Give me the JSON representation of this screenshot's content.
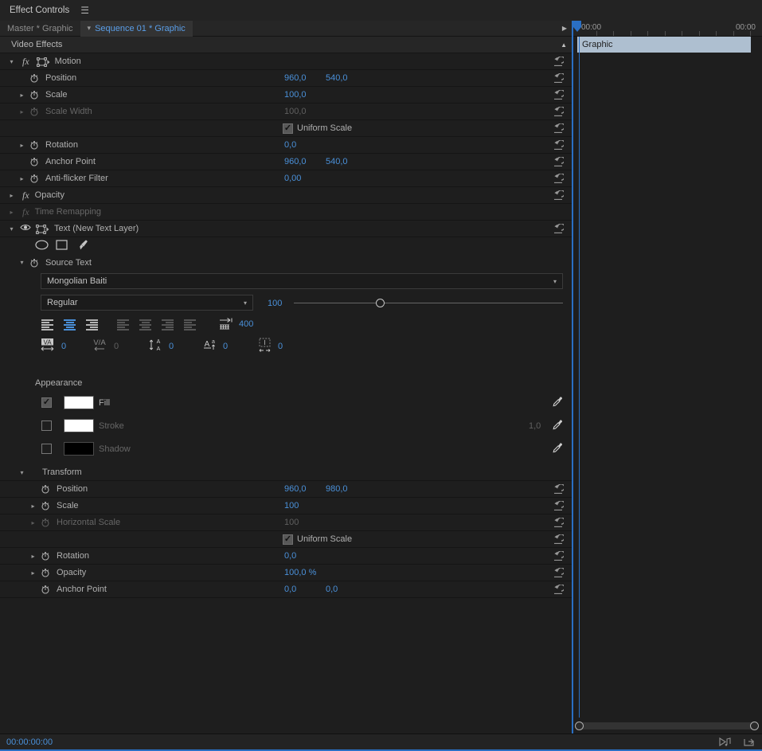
{
  "window": {
    "title": "Effect Controls",
    "menu_icon": "hamburger-menu-icon"
  },
  "tabs": {
    "master": "Master * Graphic",
    "sequence": "Sequence 01 * Graphic"
  },
  "effects_header": {
    "label": "Video Effects"
  },
  "motion": {
    "name": "Motion",
    "properties": [
      {
        "label": "Position",
        "v1": "960,0",
        "v2": "540,0",
        "disabled": false,
        "twirl": false
      },
      {
        "label": "Scale",
        "v1": "100,0",
        "v2": "",
        "disabled": false,
        "twirl": true
      },
      {
        "label": "Scale Width",
        "v1": "100,0",
        "v2": "",
        "disabled": true,
        "twirl": true
      },
      {
        "label": "Uniform Scale",
        "v1": "",
        "v2": "",
        "disabled": false,
        "twirl": false,
        "checkbox": true
      },
      {
        "label": "Rotation",
        "v1": "0,0",
        "v2": "",
        "disabled": false,
        "twirl": true
      },
      {
        "label": "Anchor Point",
        "v1": "960,0",
        "v2": "540,0",
        "disabled": false,
        "twirl": false
      },
      {
        "label": "Anti-flicker Filter",
        "v1": "0,00",
        "v2": "",
        "disabled": false,
        "twirl": true
      }
    ]
  },
  "opacity_group": {
    "label": "Opacity"
  },
  "time_remapping_group": {
    "label": "Time Remapping"
  },
  "text_layer": {
    "label": "Text (New Text Layer)",
    "tools": [
      "ellipse-tool-icon",
      "rectangle-tool-icon",
      "pen-tool-icon"
    ],
    "source_text_label": "Source Text",
    "font_family": "Mongolian Baiti",
    "font_style": "Regular",
    "font_size": "100",
    "font_size_slider_pct": 32,
    "leading": "400",
    "tracking": "0",
    "kerning": "0",
    "baseline_shift": "0",
    "vertical_offset": "0",
    "faux_value": "0",
    "align_selected_index": 1
  },
  "appearance": {
    "title": "Appearance",
    "rows": [
      {
        "label": "Fill",
        "checked": true,
        "color": "#ffffff",
        "value": "",
        "enabled": true
      },
      {
        "label": "Stroke",
        "checked": false,
        "color": "#ffffff",
        "value": "1,0",
        "enabled": false
      },
      {
        "label": "Shadow",
        "checked": false,
        "color": "#000000",
        "value": "",
        "enabled": false
      }
    ]
  },
  "transform": {
    "label": "Transform",
    "properties": [
      {
        "label": "Position",
        "v1": "960,0",
        "v2": "980,0",
        "disabled": false,
        "twirl": false
      },
      {
        "label": "Scale",
        "v1": "100",
        "v2": "",
        "disabled": false,
        "twirl": true
      },
      {
        "label": "Horizontal Scale",
        "v1": "100",
        "v2": "",
        "disabled": true,
        "twirl": true
      },
      {
        "label": "Uniform Scale",
        "v1": "",
        "v2": "",
        "disabled": false,
        "twirl": false,
        "checkbox": true
      },
      {
        "label": "Rotation",
        "v1": "0,0",
        "v2": "",
        "disabled": false,
        "twirl": true
      },
      {
        "label": "Opacity",
        "v1": "100,0 %",
        "v2": "",
        "disabled": false,
        "twirl": true
      },
      {
        "label": "Anchor Point",
        "v1": "0,0",
        "v2": "0,0",
        "disabled": false,
        "twirl": false
      }
    ]
  },
  "timeline": {
    "start_time": "00:00",
    "end_time": "00:00",
    "clip_label": "Graphic"
  },
  "statusbar": {
    "timecode": "00:00:00:00",
    "icons": [
      "play-audio-icon",
      "export-frame-icon"
    ]
  },
  "colors": {
    "accent_blue": "#4a90d9",
    "panel_bg": "#1e1e1e",
    "header_bg": "#262626",
    "clip_fill": "#aebfd0"
  }
}
